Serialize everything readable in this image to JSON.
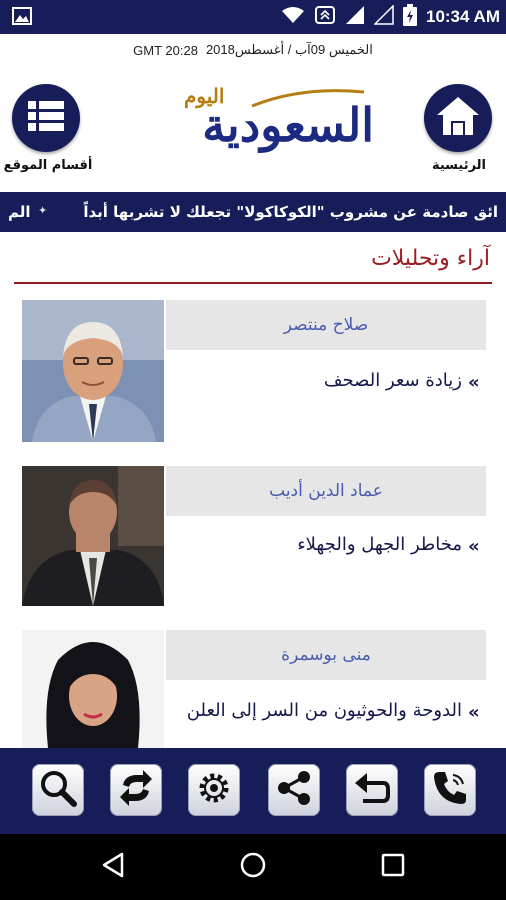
{
  "status_bar": {
    "time": "10:34 AM"
  },
  "date_line": {
    "date_text": "الخميس 09آب / أغسطس2018",
    "gmt_text": "GMT 20:28"
  },
  "header": {
    "home_label": "الرئيسية",
    "sections_label": "أقسام الموقع",
    "logo_main": "السعودية",
    "logo_sub": "اليوم"
  },
  "ticker": {
    "text": "ائق صادمة عن مشروب \"الكوكاكولا\" تجعلك لا تشربها أبداً",
    "tail": "الم"
  },
  "section": {
    "title": "آراء وتحليلات"
  },
  "articles": [
    {
      "author": "صلاح منتصر",
      "headline": "زيادة سعر الصحف"
    },
    {
      "author": "عماد الدين أديب",
      "headline": "مخاطر الجهل والجهلاء"
    },
    {
      "author": "منى بوسمرة",
      "headline": "الدوحة والحوثيون من السر إلى العلن"
    }
  ],
  "toolbar": {
    "icons": [
      "search-icon",
      "refresh-icon",
      "settings-icon",
      "share-icon",
      "back-icon",
      "call-icon"
    ]
  },
  "colors": {
    "brand_navy": "#161d59",
    "accent_red": "#9b1f23",
    "logo_blue": "#1d2a82",
    "logo_gold": "#b57d12"
  }
}
